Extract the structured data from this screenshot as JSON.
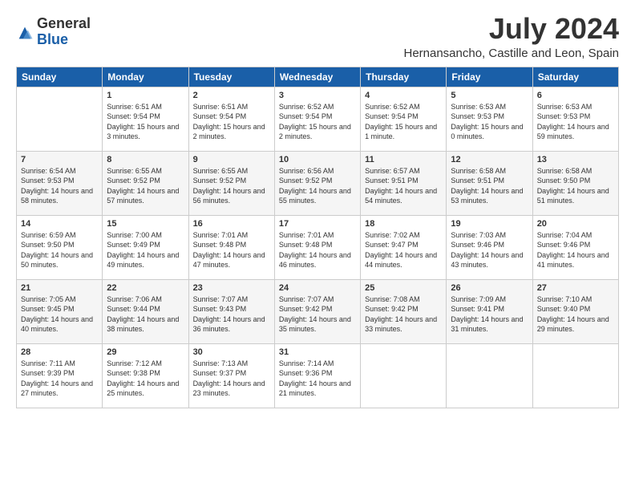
{
  "logo": {
    "general": "General",
    "blue": "Blue"
  },
  "header": {
    "month": "July 2024",
    "location": "Hernansancho, Castille and Leon, Spain"
  },
  "weekdays": [
    "Sunday",
    "Monday",
    "Tuesday",
    "Wednesday",
    "Thursday",
    "Friday",
    "Saturday"
  ],
  "weeks": [
    [
      {
        "day": "",
        "sunrise": "",
        "sunset": "",
        "daylight": ""
      },
      {
        "day": "1",
        "sunrise": "Sunrise: 6:51 AM",
        "sunset": "Sunset: 9:54 PM",
        "daylight": "Daylight: 15 hours and 3 minutes."
      },
      {
        "day": "2",
        "sunrise": "Sunrise: 6:51 AM",
        "sunset": "Sunset: 9:54 PM",
        "daylight": "Daylight: 15 hours and 2 minutes."
      },
      {
        "day": "3",
        "sunrise": "Sunrise: 6:52 AM",
        "sunset": "Sunset: 9:54 PM",
        "daylight": "Daylight: 15 hours and 2 minutes."
      },
      {
        "day": "4",
        "sunrise": "Sunrise: 6:52 AM",
        "sunset": "Sunset: 9:54 PM",
        "daylight": "Daylight: 15 hours and 1 minute."
      },
      {
        "day": "5",
        "sunrise": "Sunrise: 6:53 AM",
        "sunset": "Sunset: 9:53 PM",
        "daylight": "Daylight: 15 hours and 0 minutes."
      },
      {
        "day": "6",
        "sunrise": "Sunrise: 6:53 AM",
        "sunset": "Sunset: 9:53 PM",
        "daylight": "Daylight: 14 hours and 59 minutes."
      }
    ],
    [
      {
        "day": "7",
        "sunrise": "Sunrise: 6:54 AM",
        "sunset": "Sunset: 9:53 PM",
        "daylight": "Daylight: 14 hours and 58 minutes."
      },
      {
        "day": "8",
        "sunrise": "Sunrise: 6:55 AM",
        "sunset": "Sunset: 9:52 PM",
        "daylight": "Daylight: 14 hours and 57 minutes."
      },
      {
        "day": "9",
        "sunrise": "Sunrise: 6:55 AM",
        "sunset": "Sunset: 9:52 PM",
        "daylight": "Daylight: 14 hours and 56 minutes."
      },
      {
        "day": "10",
        "sunrise": "Sunrise: 6:56 AM",
        "sunset": "Sunset: 9:52 PM",
        "daylight": "Daylight: 14 hours and 55 minutes."
      },
      {
        "day": "11",
        "sunrise": "Sunrise: 6:57 AM",
        "sunset": "Sunset: 9:51 PM",
        "daylight": "Daylight: 14 hours and 54 minutes."
      },
      {
        "day": "12",
        "sunrise": "Sunrise: 6:58 AM",
        "sunset": "Sunset: 9:51 PM",
        "daylight": "Daylight: 14 hours and 53 minutes."
      },
      {
        "day": "13",
        "sunrise": "Sunrise: 6:58 AM",
        "sunset": "Sunset: 9:50 PM",
        "daylight": "Daylight: 14 hours and 51 minutes."
      }
    ],
    [
      {
        "day": "14",
        "sunrise": "Sunrise: 6:59 AM",
        "sunset": "Sunset: 9:50 PM",
        "daylight": "Daylight: 14 hours and 50 minutes."
      },
      {
        "day": "15",
        "sunrise": "Sunrise: 7:00 AM",
        "sunset": "Sunset: 9:49 PM",
        "daylight": "Daylight: 14 hours and 49 minutes."
      },
      {
        "day": "16",
        "sunrise": "Sunrise: 7:01 AM",
        "sunset": "Sunset: 9:48 PM",
        "daylight": "Daylight: 14 hours and 47 minutes."
      },
      {
        "day": "17",
        "sunrise": "Sunrise: 7:01 AM",
        "sunset": "Sunset: 9:48 PM",
        "daylight": "Daylight: 14 hours and 46 minutes."
      },
      {
        "day": "18",
        "sunrise": "Sunrise: 7:02 AM",
        "sunset": "Sunset: 9:47 PM",
        "daylight": "Daylight: 14 hours and 44 minutes."
      },
      {
        "day": "19",
        "sunrise": "Sunrise: 7:03 AM",
        "sunset": "Sunset: 9:46 PM",
        "daylight": "Daylight: 14 hours and 43 minutes."
      },
      {
        "day": "20",
        "sunrise": "Sunrise: 7:04 AM",
        "sunset": "Sunset: 9:46 PM",
        "daylight": "Daylight: 14 hours and 41 minutes."
      }
    ],
    [
      {
        "day": "21",
        "sunrise": "Sunrise: 7:05 AM",
        "sunset": "Sunset: 9:45 PM",
        "daylight": "Daylight: 14 hours and 40 minutes."
      },
      {
        "day": "22",
        "sunrise": "Sunrise: 7:06 AM",
        "sunset": "Sunset: 9:44 PM",
        "daylight": "Daylight: 14 hours and 38 minutes."
      },
      {
        "day": "23",
        "sunrise": "Sunrise: 7:07 AM",
        "sunset": "Sunset: 9:43 PM",
        "daylight": "Daylight: 14 hours and 36 minutes."
      },
      {
        "day": "24",
        "sunrise": "Sunrise: 7:07 AM",
        "sunset": "Sunset: 9:42 PM",
        "daylight": "Daylight: 14 hours and 35 minutes."
      },
      {
        "day": "25",
        "sunrise": "Sunrise: 7:08 AM",
        "sunset": "Sunset: 9:42 PM",
        "daylight": "Daylight: 14 hours and 33 minutes."
      },
      {
        "day": "26",
        "sunrise": "Sunrise: 7:09 AM",
        "sunset": "Sunset: 9:41 PM",
        "daylight": "Daylight: 14 hours and 31 minutes."
      },
      {
        "day": "27",
        "sunrise": "Sunrise: 7:10 AM",
        "sunset": "Sunset: 9:40 PM",
        "daylight": "Daylight: 14 hours and 29 minutes."
      }
    ],
    [
      {
        "day": "28",
        "sunrise": "Sunrise: 7:11 AM",
        "sunset": "Sunset: 9:39 PM",
        "daylight": "Daylight: 14 hours and 27 minutes."
      },
      {
        "day": "29",
        "sunrise": "Sunrise: 7:12 AM",
        "sunset": "Sunset: 9:38 PM",
        "daylight": "Daylight: 14 hours and 25 minutes."
      },
      {
        "day": "30",
        "sunrise": "Sunrise: 7:13 AM",
        "sunset": "Sunset: 9:37 PM",
        "daylight": "Daylight: 14 hours and 23 minutes."
      },
      {
        "day": "31",
        "sunrise": "Sunrise: 7:14 AM",
        "sunset": "Sunset: 9:36 PM",
        "daylight": "Daylight: 14 hours and 21 minutes."
      },
      {
        "day": "",
        "sunrise": "",
        "sunset": "",
        "daylight": ""
      },
      {
        "day": "",
        "sunrise": "",
        "sunset": "",
        "daylight": ""
      },
      {
        "day": "",
        "sunrise": "",
        "sunset": "",
        "daylight": ""
      }
    ]
  ]
}
